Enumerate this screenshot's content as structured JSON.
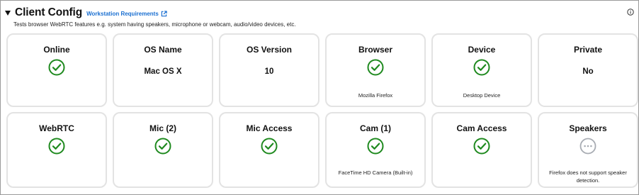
{
  "header": {
    "title": "Client Config",
    "requirements_link": "Workstation Requirements",
    "description": "Tests browser WebRTC features e.g. system having speakers, microphone or webcam, audio/video devices, etc."
  },
  "colors": {
    "success": "#1f8a1f",
    "pending": "#a8acb3",
    "link": "#1a6fd1"
  },
  "cards": [
    {
      "label": "Online",
      "status": "check-icon"
    },
    {
      "label": "OS Name",
      "value": "Mac OS X"
    },
    {
      "label": "OS Version",
      "value": "10"
    },
    {
      "label": "Browser",
      "status": "check-icon",
      "detail": "Mozilla Firefox"
    },
    {
      "label": "Device",
      "status": "check-icon",
      "detail": "Desktop Device"
    },
    {
      "label": "Private",
      "value": "No"
    },
    {
      "label": "WebRTC",
      "status": "check-icon"
    },
    {
      "label": "Mic (2)",
      "status": "check-icon"
    },
    {
      "label": "Mic Access",
      "status": "check-icon"
    },
    {
      "label": "Cam (1)",
      "status": "check-icon",
      "detail": "FaceTime HD Camera (Built-in)"
    },
    {
      "label": "Cam Access",
      "status": "check-icon"
    },
    {
      "label": "Speakers",
      "status": "ellipsis-icon",
      "detail": "Firefox does not support speaker detection."
    }
  ]
}
